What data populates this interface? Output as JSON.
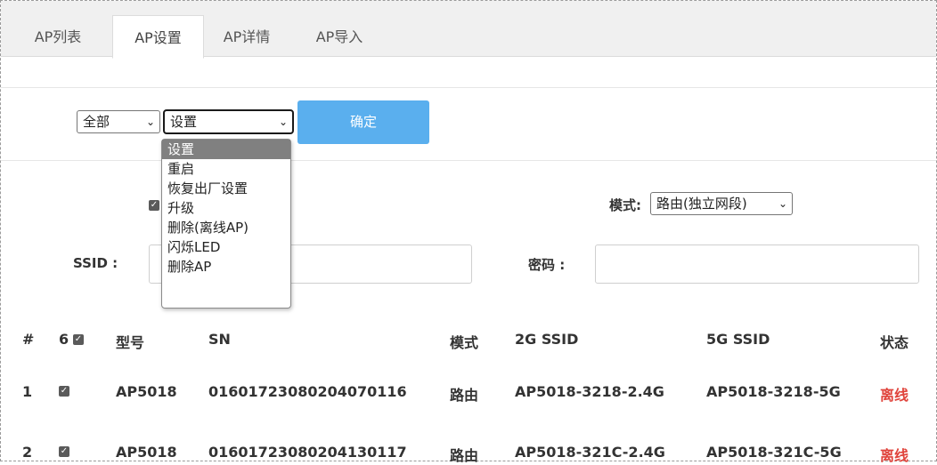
{
  "tabs": [
    {
      "label": "AP列表"
    },
    {
      "label": "AP设置"
    },
    {
      "label": "AP详情"
    },
    {
      "label": "AP导入"
    }
  ],
  "filter": {
    "scope_value": "全部",
    "action_value": "设置",
    "confirm_label": "确定",
    "action_options": [
      "设置",
      "重启",
      "恢复出厂设置",
      "升级",
      "删除(离线AP)",
      "闪烁LED",
      "删除AP"
    ]
  },
  "settings": {
    "mode_label": "模式:",
    "mode_value": "路由(独立网段)",
    "ssid_label": "SSID :",
    "password_label": "密码 :"
  },
  "table": {
    "headers": {
      "index": "#",
      "count": "6",
      "model": "型号",
      "sn": "SN",
      "mode": "模式",
      "ssid2g": "2G SSID",
      "ssid5g": "5G SSID",
      "status": "状态"
    },
    "rows": [
      {
        "index": "1",
        "model": "AP5018",
        "sn": "01601723080204070116",
        "mode": "路由",
        "ssid2g": "AP5018-3218-2.4G",
        "ssid5g": "AP5018-3218-5G",
        "status": "离线"
      },
      {
        "index": "2",
        "model": "AP5018",
        "sn": "01601723080204130117",
        "mode": "路由",
        "ssid2g": "AP5018-321C-2.4G",
        "ssid5g": "AP5018-321C-5G",
        "status": "离线"
      }
    ]
  },
  "colors": {
    "accent": "#5aafee",
    "offline": "#e0443c"
  }
}
